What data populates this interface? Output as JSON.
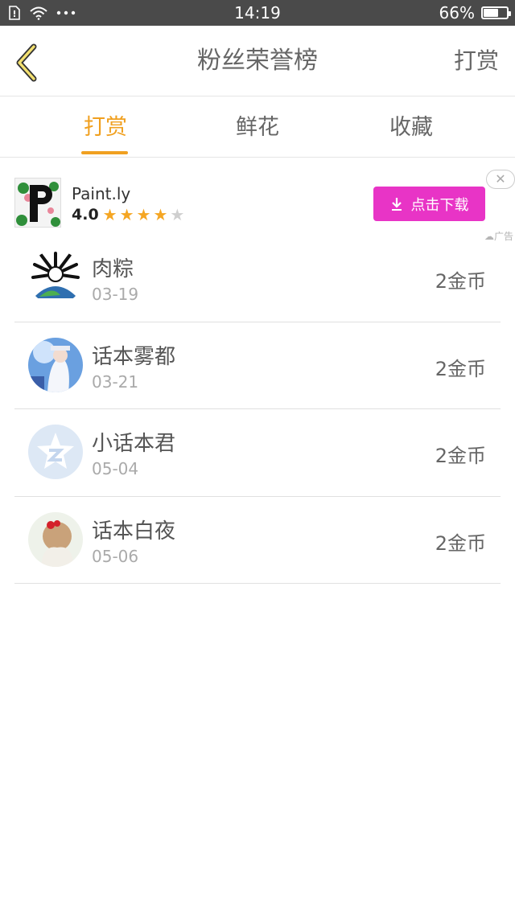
{
  "status_bar": {
    "time": "14:19",
    "battery_percent_label": "66%",
    "battery_level": 0.66,
    "icons": [
      "sim-icon",
      "wifi-icon",
      "more-dots-icon",
      "battery-icon"
    ]
  },
  "header": {
    "back_icon": "chevron-left-icon",
    "title": "粉丝荣誉榜",
    "action_label": "打赏"
  },
  "tabs": [
    {
      "label": "打赏",
      "active": true
    },
    {
      "label": "鲜花",
      "active": false
    },
    {
      "label": "收藏",
      "active": false
    }
  ],
  "colors": {
    "accent": "#f0a020",
    "ad_button": "#e834c6",
    "status_bar": "#4a4a4a"
  },
  "ad": {
    "app_name": "Paint.ly",
    "rating": "4.0",
    "stars_filled": 4,
    "stars_total": 5,
    "download_label": "点击下载",
    "download_icon": "download-icon",
    "close_icon": "close-icon",
    "ad_tag": "广告"
  },
  "list": [
    {
      "name": "肉粽",
      "date": "03-19",
      "amount": "2金币"
    },
    {
      "name": "话本雾都",
      "date": "03-21",
      "amount": "2金币"
    },
    {
      "name": "小话本君",
      "date": "05-04",
      "amount": "2金币"
    },
    {
      "name": "话本白夜",
      "date": "05-06",
      "amount": "2金币"
    }
  ]
}
